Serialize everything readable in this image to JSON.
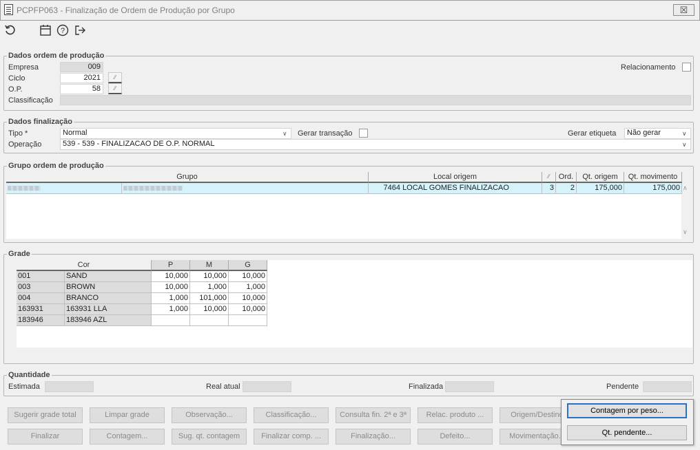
{
  "window": {
    "title": "PCPFP063 - Finalização de Ordem de Produção por Grupo",
    "close_label": "☒"
  },
  "toolbar": {
    "refresh_icon": "refresh-icon",
    "calendar_icon": "calendar-icon",
    "help_icon": "help-icon",
    "exit_icon": "exit-icon"
  },
  "dados_op": {
    "legend": "Dados ordem de produção",
    "empresa_label": "Empresa",
    "empresa_value": "009",
    "ciclo_label": "Ciclo",
    "ciclo_value": "2021",
    "op_label": "O.P.",
    "op_value": "58",
    "classificacao_label": "Classificação",
    "classificacao_value": "",
    "relacionamento_label": "Relacionamento"
  },
  "dados_fin": {
    "legend": "Dados finalização",
    "tipo_label": "Tipo *",
    "tipo_value": "Normal",
    "gerar_transacao_label": "Gerar transação",
    "gerar_etiqueta_label": "Gerar etiqueta",
    "gerar_etiqueta_value": "Não gerar",
    "operacao_label": "Operação",
    "operacao_value": "539 - 539 - FINALIZACAO DE O.P. NORMAL"
  },
  "grupo_op": {
    "legend": "Grupo ordem de produção",
    "headers": [
      "Grupo",
      "Local origem",
      "",
      "Ord.",
      "Qt. origem",
      "Qt. movimento"
    ],
    "rows": [
      {
        "local_code": "7464",
        "local_name": "LOCAL GOMES FINALIZACAO",
        "check": "3",
        "ord": "2",
        "qt_origem": "175,000",
        "qt_movimento": "175,000"
      }
    ]
  },
  "grade": {
    "legend": "Grade",
    "headers": [
      "Cor",
      "P",
      "M",
      "G"
    ],
    "rows": [
      {
        "code": "001",
        "name": "SAND",
        "p": "10,000",
        "m": "10,000",
        "g": "10,000"
      },
      {
        "code": "003",
        "name": "BROWN",
        "p": "10,000",
        "m": "1,000",
        "g": "1,000"
      },
      {
        "code": "004",
        "name": "BRANCO",
        "p": "1,000",
        "m": "101,000",
        "g": "10,000"
      },
      {
        "code": "163931",
        "name": "163931 LLA",
        "p": "1,000",
        "m": "10,000",
        "g": "10,000"
      },
      {
        "code": "183946",
        "name": "183946 AZL",
        "p": "",
        "m": "",
        "g": ""
      }
    ]
  },
  "quantidade": {
    "legend": "Quantidade",
    "estimada_label": "Estimada",
    "real_atual_label": "Real atual",
    "finalizada_label": "Finalizada",
    "pendente_label": "Pendente"
  },
  "buttons": {
    "row1": [
      "Sugerir grade total",
      "Limpar grade",
      "Observação...",
      "Classificação...",
      "Consulta fin. 2ª e 3ª",
      "Relac. produto ...",
      "Origem/Destino"
    ],
    "row2": [
      "Finalizar",
      "Contagem...",
      "Sug. qt. contagem",
      "Finalizar comp. ...",
      "Finalização...",
      "Defeito...",
      "Movimentação..."
    ]
  },
  "popup": {
    "contagem_peso": "Contagem por peso...",
    "qt_pendente": "Qt. pendente..."
  }
}
